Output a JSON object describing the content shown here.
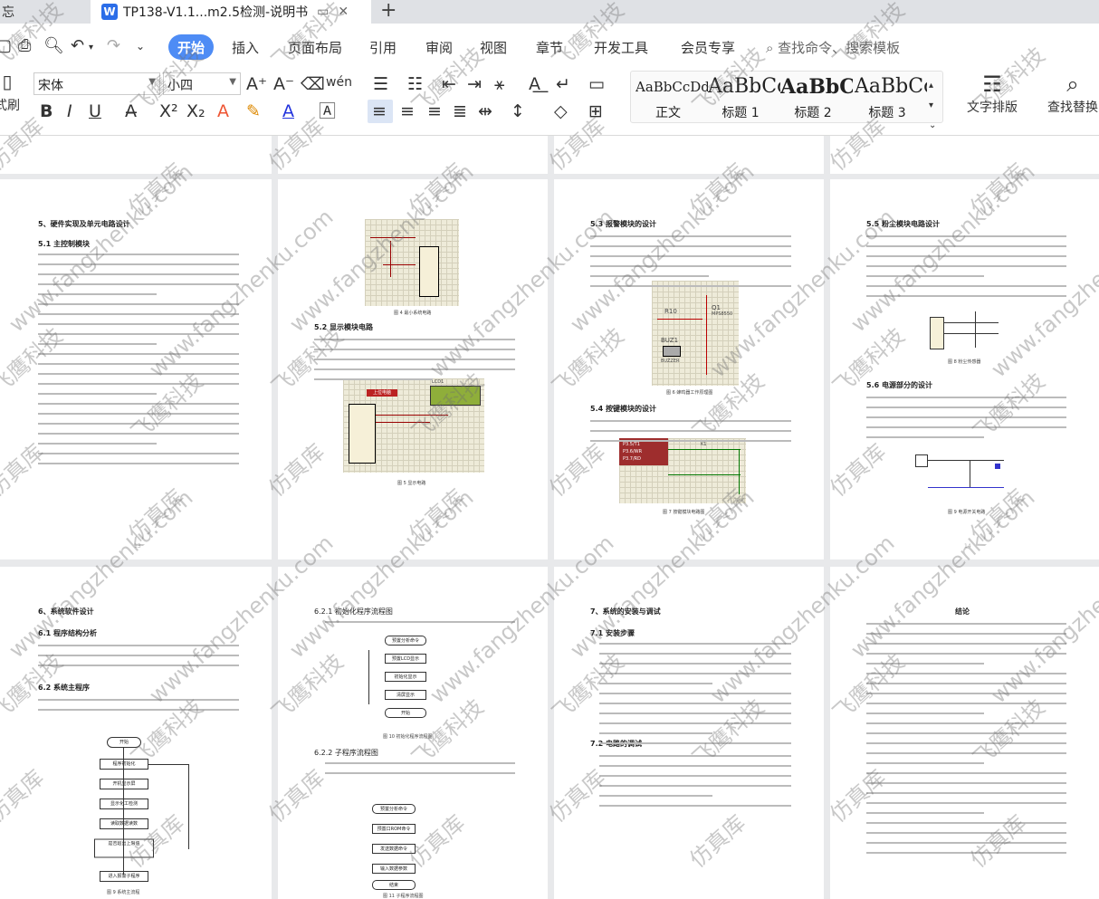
{
  "tabs": [
    {
      "label": "忘"
    },
    {
      "label": "TP138-V1.1...m2.5检测-说明书",
      "icon": "W"
    }
  ],
  "toolbar": {
    "menus": [
      "开始",
      "插入",
      "页面布局",
      "引用",
      "审阅",
      "视图",
      "章节",
      "开发工具",
      "会员专享"
    ],
    "search": "查找命令、搜索模板",
    "brush": "式刷",
    "font_name": "宋体",
    "font_size": "小四",
    "wen_label": "wén",
    "styles": [
      {
        "preview": "AaBbCcDd",
        "label": "正文"
      },
      {
        "preview": "AaBbCc",
        "label": "标题 1"
      },
      {
        "preview": "AaBbC",
        "label": "标题 2"
      },
      {
        "preview": "AaBbCc",
        "label": "标题 3"
      }
    ],
    "text_layout": "文字排版",
    "find_replace": "查找替换"
  },
  "pages_row1": [
    {
      "h1": "5、硬件实现及单元电路设计",
      "h2": "5.1 主控制模块",
      "h3": "",
      "cap": "",
      "cap2": "",
      "num": "13"
    },
    {
      "h1": "",
      "h2": "5.2 显示模块电路",
      "h3": "",
      "cap": "图 4 最小系统电路",
      "cap2": "图 5 显示电路",
      "num": ""
    },
    {
      "h1": "",
      "h2": "5.3 报警模块的设计",
      "h3": "5.4 按键模块的设计",
      "cap": "图 6 蜂鸣器工作原理图",
      "cap2": "图 7 按键模块电路图",
      "num": ""
    },
    {
      "h1": "",
      "h2": "5.5 粉尘模块电路设计",
      "h3": "5.6 电源部分的设计",
      "cap": "图 8 粉尘传感器",
      "cap2": "图 9 电源开关电路",
      "num": "14"
    }
  ],
  "pages_row2": [
    {
      "h1": "6、系统软件设计",
      "h2": "6.1 程序结构分析",
      "h3": "6.2 系统主程序",
      "cap": "图 9  系统主流程",
      "num": ""
    },
    {
      "h1": "",
      "h2": "6.2.1 初始化程序流程图",
      "h3": "6.2.2 子程序流程图",
      "cap": "图 10 初始化程序流程图",
      "cap2": "图 11 子程序流程图",
      "num": ""
    },
    {
      "h1": "7、系统的安装与调试",
      "h2": "7.1 安装步骤",
      "h3": "7.2 电路的调试",
      "cap": "",
      "num": ""
    },
    {
      "h1": "结论",
      "h2": "",
      "h3": "",
      "cap": "",
      "num": ""
    }
  ],
  "circuit_labels": {
    "r10": "R10",
    "q1": "Q1",
    "q1_part": "MPS8550",
    "buz1": "BUZ1",
    "buzzer": "BUZZER",
    "lcd": "LCD1",
    "p35": "P3.5/T1",
    "p36": "P3.6/WR",
    "p37": "P3.7/RD",
    "k1": "K1"
  },
  "flow1": [
    "开始",
    "程序初始化",
    "开机显示屏",
    "显示化工检测",
    "读取数据读数",
    "是否超出上限值",
    "进入报警子程序"
  ],
  "flow2": [
    "预置分析命令",
    "预置LCD显示",
    "初始化显示",
    "清屏显示",
    "开始"
  ],
  "flow3": [
    "预置分析命令",
    "预置口ROM命令",
    "发送数据命令",
    "输入数据参数",
    "结束"
  ],
  "watermarks": [
    "飞鹰科技",
    "仿真库",
    "www.fangzhenku.com"
  ]
}
